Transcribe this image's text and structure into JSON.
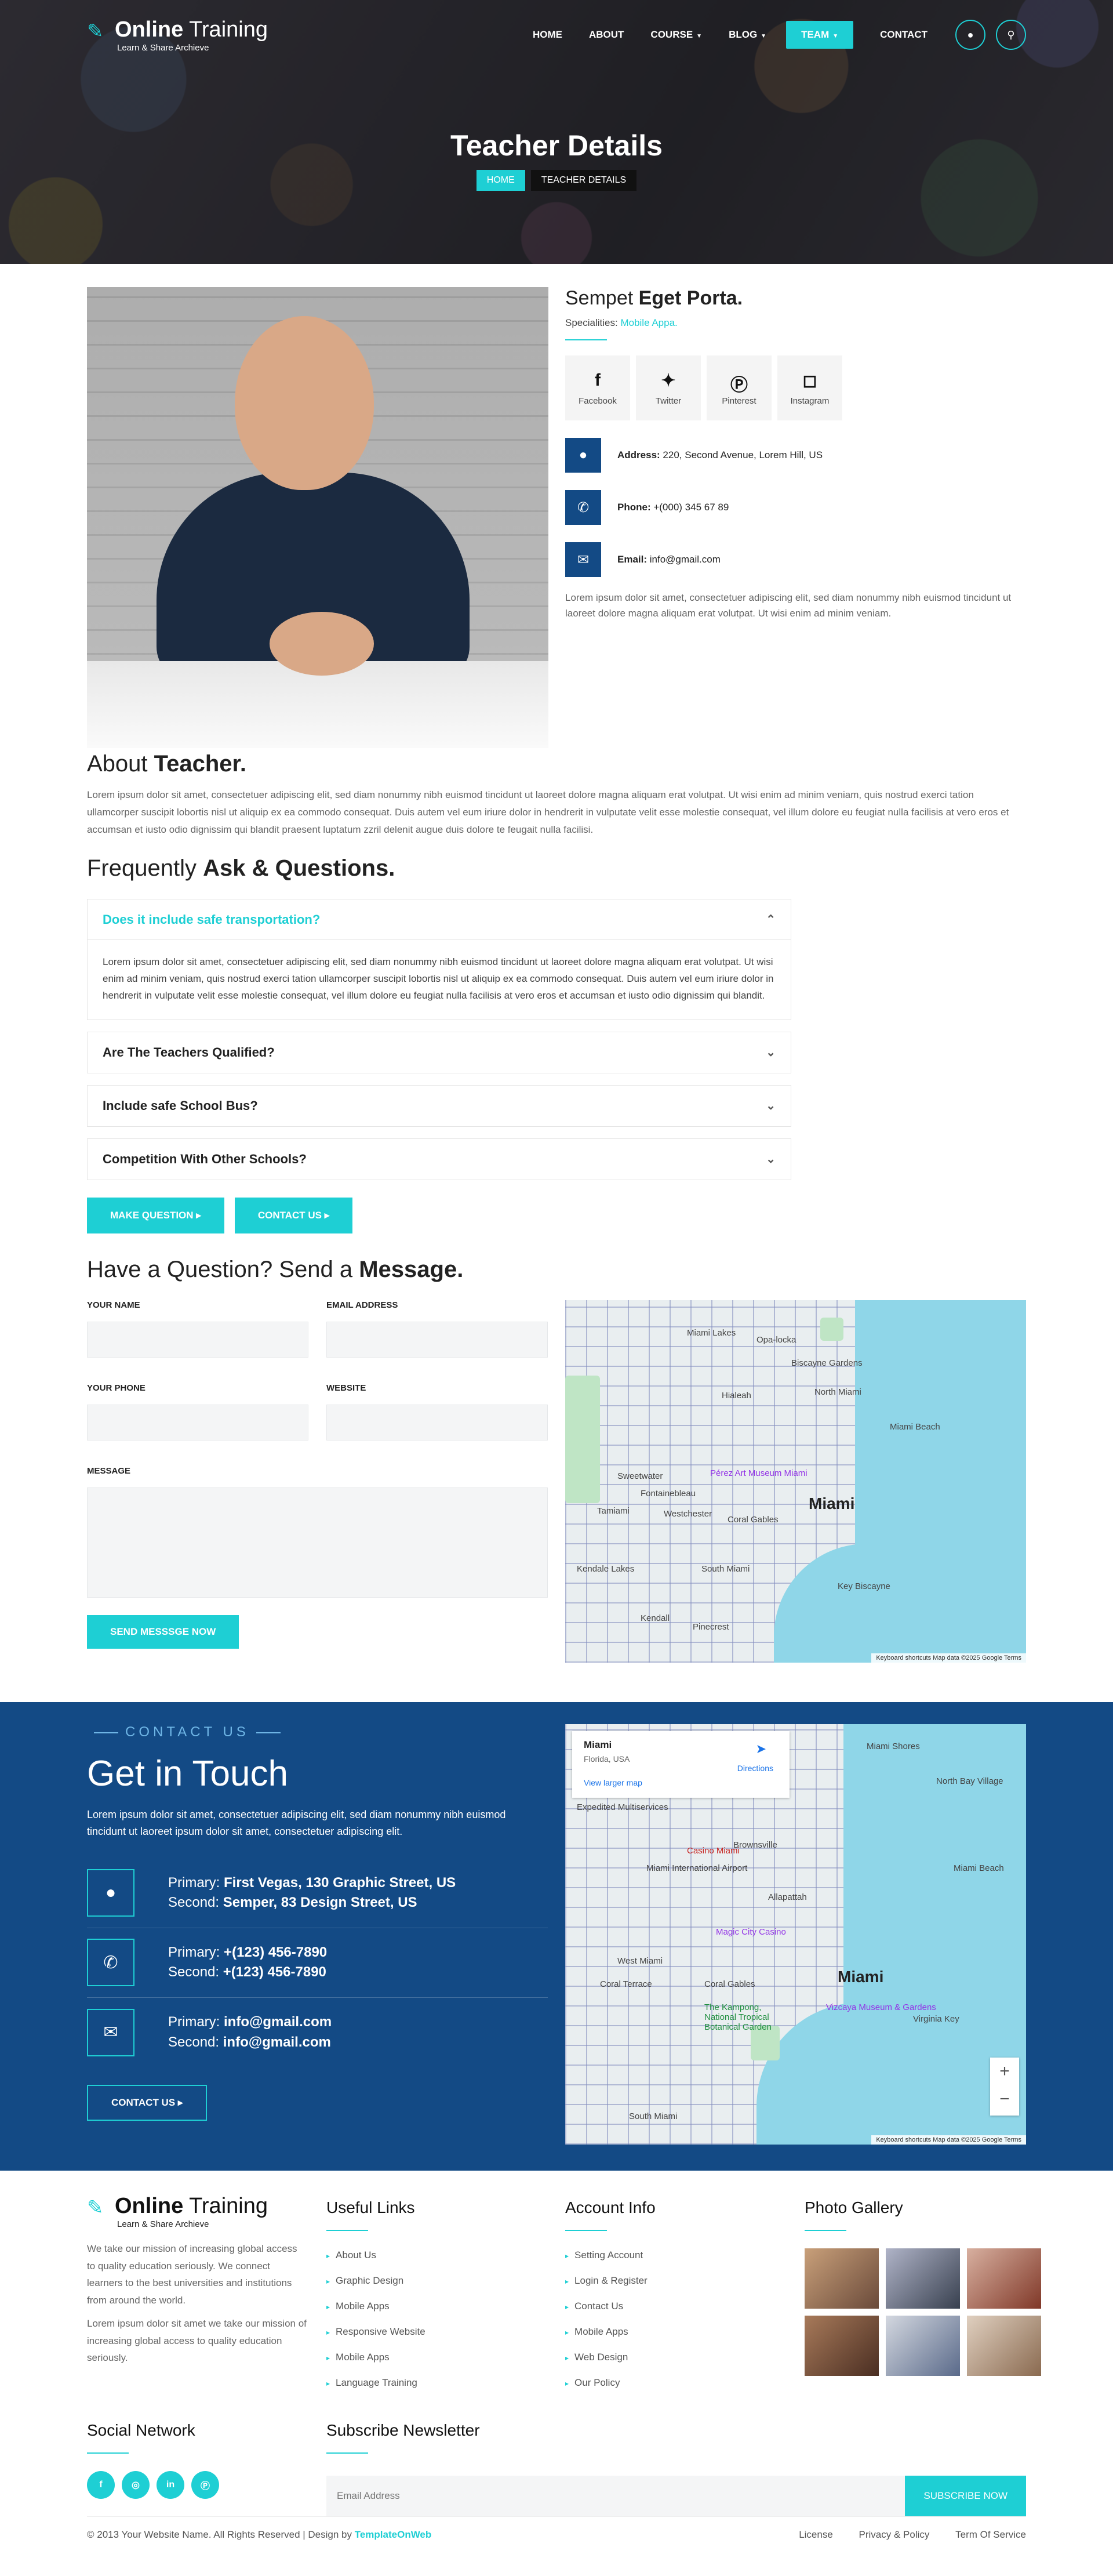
{
  "brand": {
    "name_bold": "Online",
    "name_rest": " Training",
    "tagline": "Learn & Share Archieve"
  },
  "nav": {
    "items": [
      "HOME",
      "ABOUT",
      "COURSE",
      "BLOG",
      "TEAM",
      "CONTACT"
    ],
    "active": "TEAM",
    "icons": [
      "user-icon",
      "search-icon"
    ]
  },
  "hero": {
    "title": "Teacher Details",
    "crumb_home": "HOME",
    "crumb_current": "TEACHER DETAILS"
  },
  "teacher": {
    "name_light": "Sempet",
    "name_bold": "Eget Porta.",
    "spec_label": "Specialities:",
    "spec_value": "Mobile Appa.",
    "socials": [
      "Facebook",
      "Twitter",
      "Pinterest",
      "Instagram"
    ],
    "address_label": "Address:",
    "address": "220, Second Avenue, Lorem Hill, US",
    "phone_label": "Phone:",
    "phone": "+(000) 345 67 89",
    "email_label": "Email:",
    "email": "info@gmail.com",
    "description": "Lorem ipsum dolor sit amet, consectetuer adipiscing elit, sed diam nonummy nibh euismod tincidunt ut laoreet dolore magna aliquam erat volutpat. Ut wisi enim ad minim veniam."
  },
  "about": {
    "title_light": "About",
    "title_bold": "Teacher.",
    "text": "Lorem ipsum dolor sit amet, consectetuer adipiscing elit, sed diam nonummy nibh euismod tincidunt ut laoreet dolore magna aliquam erat volutpat. Ut wisi enim ad minim veniam, quis nostrud exerci tation ullamcorper suscipit lobortis nisl ut aliquip ex ea commodo consequat. Duis autem vel eum iriure dolor in hendrerit in vulputate velit esse molestie consequat, vel illum dolore eu feugiat nulla facilisis at vero eros et accumsan et iusto odio dignissim qui blandit praesent luptatum zzril delenit augue duis dolore te feugait nulla facilisi."
  },
  "faq": {
    "title_light": "Frequently",
    "title_bold": "Ask & Questions.",
    "items": [
      {
        "q": "Does it include safe transportation?",
        "a": "Lorem ipsum dolor sit amet, consectetuer adipiscing elit, sed diam nonummy nibh euismod tincidunt ut laoreet dolore magna aliquam erat volutpat. Ut wisi enim ad minim veniam, quis nostrud exerci tation ullamcorper suscipit lobortis nisl ut aliquip ex ea commodo consequat. Duis autem vel eum iriure dolor in hendrerit in vulputate velit esse molestie consequat, vel illum dolore eu feugiat nulla facilisis at vero eros et accumsan et iusto odio dignissim qui blandit."
      },
      {
        "q": "Are The Teachers Qualified?"
      },
      {
        "q": "Include safe School Bus?"
      },
      {
        "q": "Competition With Other Schools?"
      }
    ],
    "btn_question": "MAKE QUESTION",
    "btn_contact": "CONTACT US"
  },
  "message": {
    "title_light": "Have a Question? Send a",
    "title_bold": "Message.",
    "labels": [
      "YOUR NAME",
      "EMAIL ADDRESS",
      "YOUR PHONE",
      "WEBSITE",
      "MESSAGE"
    ],
    "send": "SEND MESSSGE NOW",
    "map": {
      "city": "Miami",
      "places": [
        "Miami Lakes",
        "Opa-locka",
        "Biscayne Gardens",
        "Hialeah",
        "Miami Beach",
        "Pérez Art Museum Miami",
        "Sweetwater",
        "Fontainebleau",
        "Westchester",
        "Coral Gables",
        "Tamiami",
        "Kendale Lakes",
        "South Miami",
        "Key Biscayne",
        "Pinecrest",
        "Kendall",
        "North Miami"
      ],
      "footer": "Keyboard shortcuts   Map data ©2025 Google   Terms"
    }
  },
  "contact": {
    "kicker": "CONTACT US",
    "title": "Get in Touch",
    "text": "Lorem ipsum dolor sit amet, consectetuer adipiscing elit, sed diam nonummy nibh euismod tincidunt ut laoreet ipsum dolor sit amet, consectetuer adipiscing elit.",
    "rows": [
      {
        "icon": "map-marker-icon",
        "p_label": "Primary:",
        "p": "First Vegas, 130 Graphic Street, US",
        "s_label": "Second:",
        "s": "Semper, 83 Design Street, US"
      },
      {
        "icon": "phone-icon",
        "p_label": "Primary:",
        "p": "+(123) 456-7890",
        "s_label": "Second:",
        "s": "+(123) 456-7890"
      },
      {
        "icon": "envelope-icon",
        "p_label": "Primary:",
        "p": "info@gmail.com",
        "s_label": "Second:",
        "s": "info@gmail.com"
      }
    ],
    "button": "CONTACT US",
    "map": {
      "card_title": "Miami",
      "card_sub": "Florida, USA",
      "card_link": "View larger map",
      "directions": "Directions",
      "city": "Miami",
      "places": [
        "Miami Shores",
        "North Bay Village",
        "Brownsville",
        "Miami International Airport",
        "Allapattah",
        "Miami Beach",
        "Magic City Casino",
        "West Miami",
        "Coral Terrace",
        "Coral Gables",
        "The Kampong, National Tropical Botanical Garden",
        "South Miami",
        "Vizcaya Museum & Gardens",
        "Virginia Key",
        "Expedited Multiservices",
        "Casino Miami"
      ],
      "footer": "Keyboard shortcuts   Map data ©2025 Google   Terms"
    }
  },
  "footer": {
    "about_p1": "We take our mission of increasing global access to quality education seriously. We connect learners to the best universities and institutions from around the world.",
    "about_p2": "Lorem ipsum dolor sit amet we take our mission of increasing global access to quality education seriously.",
    "useful": {
      "title": "Useful Links",
      "items": [
        "About Us",
        "Graphic Design",
        "Mobile Apps",
        "Responsive Website",
        "Mobile Apps",
        "Language Training"
      ]
    },
    "account": {
      "title": "Account Info",
      "items": [
        "Setting Account",
        "Login & Register",
        "Contact Us",
        "Mobile Apps",
        "Web Design",
        "Our Policy"
      ]
    },
    "gallery": {
      "title": "Photo Gallery"
    },
    "social": {
      "title": "Social Network",
      "icons": [
        "facebook-icon",
        "dribbble-icon",
        "linkedin-icon",
        "pinterest-icon"
      ]
    },
    "newsletter": {
      "title": "Subscribe Newsletter",
      "placeholder": "Email Address",
      "button": "SUBSCRIBE NOW"
    },
    "copyright": "© 2013 Your Website Name. All Rights Reserved | Design by",
    "designer": "TemplateOnWeb",
    "legal": [
      "License",
      "Privacy & Policy",
      "Term Of Service"
    ]
  }
}
